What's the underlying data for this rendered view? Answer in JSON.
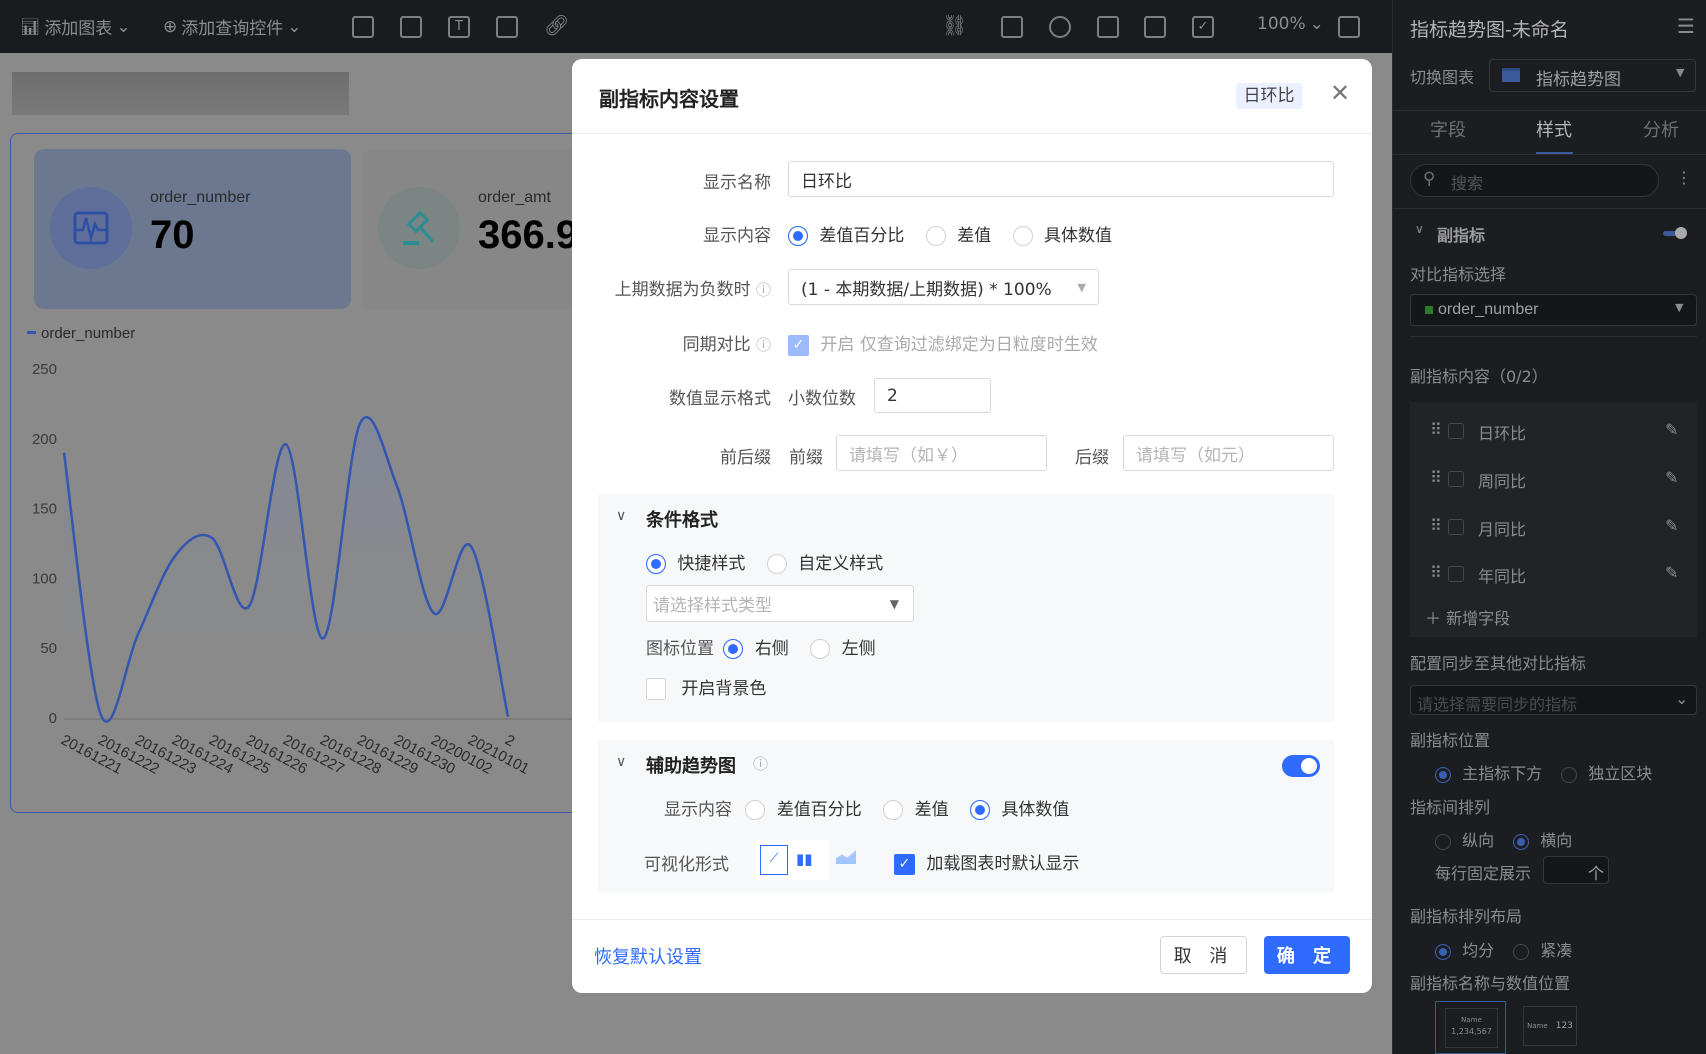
{
  "topbar": {
    "add_chart": "添加图表",
    "add_query_control": "添加查询控件",
    "zoom": "100%"
  },
  "canvas": {
    "cards": [
      {
        "name": "order_number",
        "value": "70",
        "icon": "pulse-icon"
      },
      {
        "name": "order_amt",
        "value": "366.9",
        "icon": "gavel-icon"
      }
    ]
  },
  "chart_data": {
    "type": "line",
    "legend": [
      "order_number"
    ],
    "series": [
      {
        "name": "order_number",
        "values": [
          190,
          2,
          60,
          116,
          129,
          80,
          196,
          57,
          211,
          166,
          75,
          123,
          1
        ]
      }
    ],
    "categories": [
      "20161221",
      "20161222",
      "20161223",
      "20161224",
      "20161225",
      "20161226",
      "20161227",
      "20161228",
      "20161229",
      "20161230",
      "20200102",
      "20210101",
      "2"
    ],
    "yticks": [
      "0",
      "50",
      "100",
      "150",
      "200",
      "250"
    ],
    "ylim": [
      0,
      250
    ],
    "smooth": true,
    "color": "#3356b0"
  },
  "modal": {
    "title": "副指标内容设置",
    "tag": "日环比",
    "display_name_label": "显示名称",
    "display_name_value": "日环比",
    "display_content_label": "显示内容",
    "display_content_options": [
      "差值百分比",
      "差值",
      "具体数值"
    ],
    "display_content_selected": 0,
    "negative_label": "上期数据为负数时",
    "negative_value": "(1 - 本期数据/上期数据) * 100%",
    "same_period_label": "同期对比",
    "same_period_check": "开启",
    "same_period_hint": "仅查询过滤绑定为日粒度时生效",
    "number_format_label": "数值显示格式",
    "decimal_label": "小数位数",
    "decimal_value": "2",
    "affix_label": "前后缀",
    "prefix_label": "前缀",
    "prefix_placeholder": "请填写（如￥）",
    "suffix_label": "后缀",
    "suffix_placeholder": "请填写（如元）",
    "cond": {
      "title": "条件格式",
      "options": [
        "快捷样式",
        "自定义样式"
      ],
      "style_placeholder": "请选择样式类型",
      "icon_pos_label": "图标位置",
      "icon_pos_options": [
        "右侧",
        "左侧"
      ],
      "bg_label": "开启背景色"
    },
    "trend": {
      "title": "辅助趋势图",
      "enabled": true,
      "content_label": "显示内容",
      "content_options": [
        "差值百分比",
        "差值",
        "具体数值"
      ],
      "vis_label": "可视化形式",
      "default_show_label": "加载图表时默认显示"
    },
    "reset": "恢复默认设置",
    "cancel": "取 消",
    "ok": "确 定",
    "accent": "#2f6bff"
  },
  "sidebar": {
    "title": "指标趋势图-未命名",
    "switch_label": "切换图表",
    "chart_type": "指标趋势图",
    "tabs": [
      "字段",
      "样式",
      "分析"
    ],
    "active_tab": 1,
    "search_placeholder": "搜索",
    "section": "副指标",
    "compare_label": "对比指标选择",
    "compare_value": "order_number",
    "content_label": "副指标内容（0/2）",
    "items": [
      "日环比",
      "周同比",
      "月同比",
      "年同比"
    ],
    "add_field": "新增字段",
    "sync_label": "配置同步至其他对比指标",
    "sync_placeholder": "请选择需要同步的指标",
    "position_label": "副指标位置",
    "position_options": [
      "主指标下方",
      "独立区块"
    ],
    "arrange_label": "指标间排列",
    "arrange_options": [
      "纵向",
      "横向"
    ],
    "per_row_label": "每行固定展示",
    "per_row_unit": "个",
    "layout_label": "副指标排列布局",
    "layout_options": [
      "均分",
      "紧凑"
    ],
    "name_pos_label": "副指标名称与数值位置",
    "thumb1_name": "Name",
    "thumb1_value": "1,234,567",
    "thumb2_name": "Name",
    "thumb2_value": "123"
  }
}
